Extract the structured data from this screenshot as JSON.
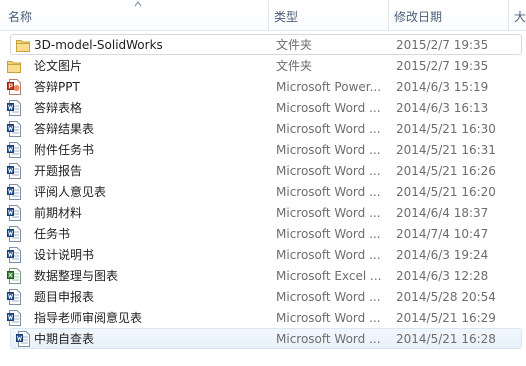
{
  "columns": {
    "name": "名称",
    "type": "类型",
    "date": "修改日期",
    "size": "大"
  },
  "sort": {
    "column": "name",
    "direction": "ascending"
  },
  "colors": {
    "folder": "#e8c35a",
    "word_blue": "#2b5797",
    "ppt_red": "#c8432b",
    "excel_green": "#2f7d3a",
    "header_text": "#4c607a",
    "meta_text": "#6d6d6d"
  },
  "files": [
    {
      "icon": "folder-icon",
      "name": "3D-model-SolidWorks",
      "type": "文件夹",
      "date": "2015/2/7 19:35",
      "state": "focused"
    },
    {
      "icon": "folder-icon",
      "name": "论文图片",
      "type": "文件夹",
      "date": "2015/2/7 19:35",
      "state": ""
    },
    {
      "icon": "powerpoint-file-icon",
      "name": "答辩PPT",
      "type": "Microsoft Power...",
      "date": "2014/6/3 15:19",
      "state": ""
    },
    {
      "icon": "word-file-icon",
      "name": "答辩表格",
      "type": "Microsoft Word ...",
      "date": "2014/6/3 16:13",
      "state": ""
    },
    {
      "icon": "word-file-icon",
      "name": "答辩结果表",
      "type": "Microsoft Word ...",
      "date": "2014/5/21 16:30",
      "state": ""
    },
    {
      "icon": "word-file-icon",
      "name": "附件任务书",
      "type": "Microsoft Word ...",
      "date": "2014/5/21 16:31",
      "state": ""
    },
    {
      "icon": "word-file-icon",
      "name": "开题报告",
      "type": "Microsoft Word ...",
      "date": "2014/5/21 16:26",
      "state": ""
    },
    {
      "icon": "word-file-icon",
      "name": "评阅人意见表",
      "type": "Microsoft Word ...",
      "date": "2014/5/21 16:20",
      "state": ""
    },
    {
      "icon": "word-file-icon",
      "name": "前期材料",
      "type": "Microsoft Word ...",
      "date": "2014/6/4 18:37",
      "state": ""
    },
    {
      "icon": "word-file-icon",
      "name": "任务书",
      "type": "Microsoft Word ...",
      "date": "2014/7/4 10:47",
      "state": ""
    },
    {
      "icon": "word-file-icon",
      "name": "设计说明书",
      "type": "Microsoft Word ...",
      "date": "2014/6/3 19:24",
      "state": ""
    },
    {
      "icon": "excel-file-icon",
      "name": "数据整理与图表",
      "type": "Microsoft Excel ...",
      "date": "2014/6/3 12:28",
      "state": ""
    },
    {
      "icon": "word-file-icon",
      "name": "题目申报表",
      "type": "Microsoft Word ...",
      "date": "2014/5/28 20:54",
      "state": ""
    },
    {
      "icon": "word-file-icon",
      "name": "指导老师审阅意见表",
      "type": "Microsoft Word ...",
      "date": "2014/5/21 16:29",
      "state": ""
    },
    {
      "icon": "word-file-icon",
      "name": "中期自查表",
      "type": "Microsoft Word ...",
      "date": "2014/5/21 16:28",
      "state": "hovered"
    }
  ]
}
